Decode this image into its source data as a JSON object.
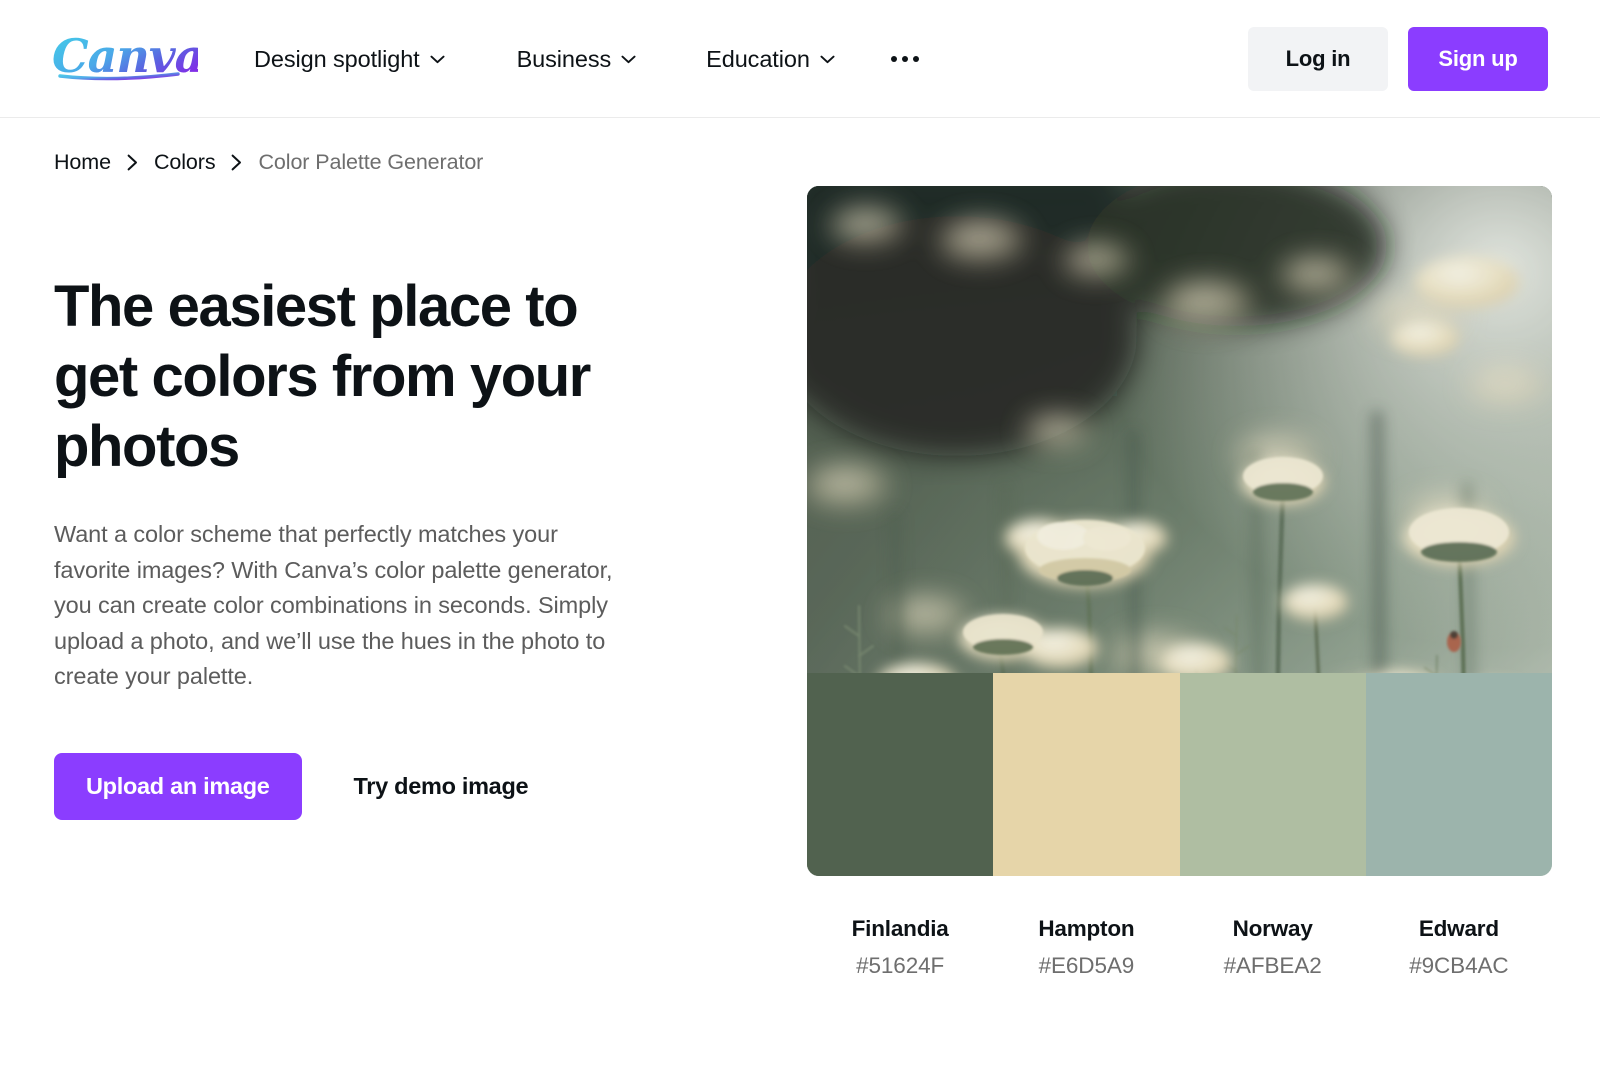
{
  "header": {
    "logo_text": "Canva",
    "logo_gradient_start": "#38b7e0",
    "logo_gradient_end": "#8b3dff",
    "nav": [
      {
        "label": "Design spotlight",
        "icon": "chevron-down-icon"
      },
      {
        "label": "Business",
        "icon": "chevron-down-icon"
      },
      {
        "label": "Education",
        "icon": "chevron-down-icon"
      }
    ],
    "more_icon": "ellipsis-icon",
    "login_label": "Log in",
    "signup_label": "Sign up",
    "signup_color": "#8b3dff",
    "login_bg": "#f2f3f5"
  },
  "breadcrumb": {
    "items": [
      {
        "label": "Home",
        "current": false
      },
      {
        "label": "Colors",
        "current": false
      },
      {
        "label": "Color Palette Generator",
        "current": true
      }
    ],
    "separator_icon": "chevron-right-icon"
  },
  "hero": {
    "title": "The easiest place to get colors from your photos",
    "body": "Want a color scheme that perfectly matches your favorite images? With Canva’s color palette generator, you can create color combinations in seconds. Simply upload a photo, and we’ll use the hues in the photo to create your palette.",
    "upload_label": "Upload an image",
    "demo_label": "Try demo image",
    "upload_color": "#8b3dff"
  },
  "palette": {
    "photo_alt": "Field of cream colored yarrow wildflowers on green stems",
    "swatches": [
      {
        "name": "Finlandia",
        "hex": "#51624F"
      },
      {
        "name": "Hampton",
        "hex": "#E6D5A9"
      },
      {
        "name": "Norway",
        "hex": "#AFBEA2"
      },
      {
        "name": "Edward",
        "hex": "#9CB4AC"
      }
    ]
  }
}
